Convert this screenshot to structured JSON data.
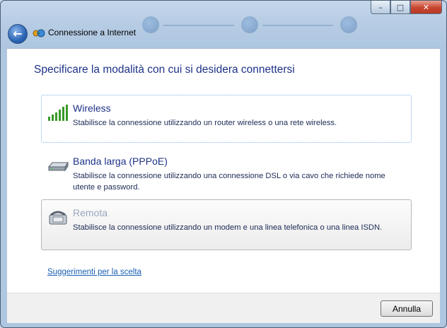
{
  "window": {
    "title": "Connessione a Internet",
    "controls": {
      "minimize": "–",
      "maximize": "□",
      "close": "✕"
    }
  },
  "heading": "Specificare la modalità con cui si desidera connettersi",
  "options": [
    {
      "title": "Wireless",
      "description": "Stabilisce la connessione utilizzando un router wireless o una rete wireless.",
      "icon": "wireless-signal-icon",
      "state": "focused"
    },
    {
      "title": "Banda larga (PPPoE)",
      "description": "Stabilisce la connessione utilizzando una connessione DSL o via cavo che richiede nome utente e password.",
      "icon": "broadband-modem-icon",
      "state": "normal"
    },
    {
      "title": "Remota",
      "description": "Stabilisce la connessione utilizzando un modem e una linea telefonica o una linea ISDN.",
      "icon": "telephone-modem-icon",
      "state": "disabled-hover"
    }
  ],
  "help_link": "Suggerimenti per la scelta",
  "footer": {
    "cancel_label": "Annulla"
  },
  "colors": {
    "heading": "#1e3287",
    "link": "#1a5fb4",
    "focus_border": "#7eb4ea"
  }
}
